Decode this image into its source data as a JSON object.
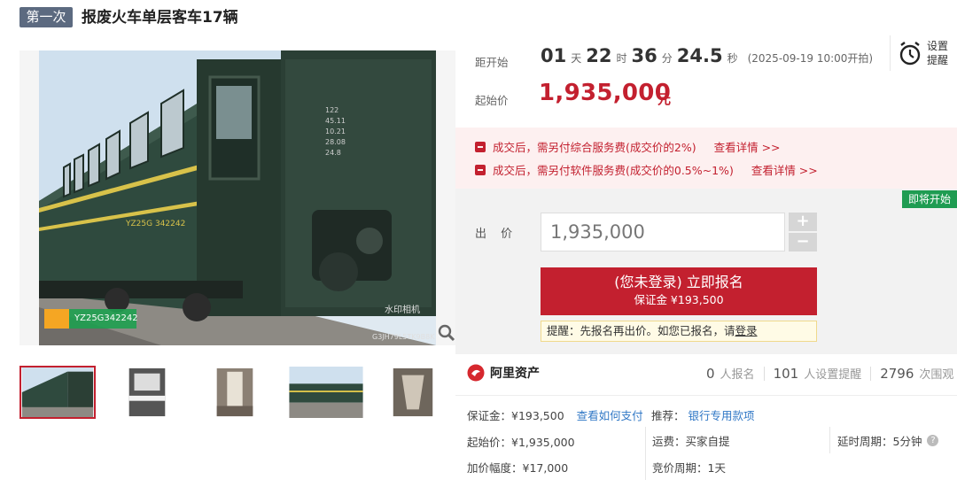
{
  "header": {
    "round_tag": "第一次",
    "title": "报废火车单层客车17辆"
  },
  "gallery": {
    "plate_text": "YZ25G342242",
    "thumbnails": [
      "thumb-1",
      "thumb-2",
      "thumb-3",
      "thumb-4",
      "thumb-5"
    ]
  },
  "countdown": {
    "label": "距开始",
    "days": "01",
    "days_unit": "天",
    "hours": "22",
    "hours_unit": "时",
    "minutes": "36",
    "minutes_unit": "分",
    "seconds": "24.5",
    "seconds_unit": "秒",
    "start_note": "(2025-09-19 10:00开拍)"
  },
  "alarm": {
    "line1": "设置",
    "line2": "提醒",
    "icon": "alarm-clock-icon"
  },
  "starting_price": {
    "label": "起始价",
    "value": "1,935,000",
    "unit": "元"
  },
  "fees": [
    {
      "text": "成交后，需另付综合服务费(成交价的2%)",
      "link": "查看详情 >>"
    },
    {
      "text": "成交后，需另付软件服务费(成交价的0.5%~1%)",
      "link": "查看详情 >>"
    }
  ],
  "bid": {
    "status_badge": "即将开始",
    "label": "出 价",
    "value": "1,935,000",
    "plus": "+",
    "minus": "−",
    "button_line1": "(您未登录) 立即报名",
    "button_line2": "保证金 ¥193,500",
    "tip_prefix": "提醒：先报名再出价。如您已报名，请",
    "tip_link": "登录"
  },
  "brand": {
    "name": "阿里资产"
  },
  "stats": {
    "signups": "0",
    "signups_unit": "人报名",
    "reminders": "101",
    "reminders_unit": "人设置提醒",
    "views": "2796",
    "views_unit": "次围观"
  },
  "info": {
    "deposit_label": "保证金：",
    "deposit_value": "¥193,500",
    "deposit_link": "查看如何支付",
    "recommend_label": "推荐：",
    "recommend_link": "银行专用款项",
    "start_label": "起始价：",
    "start_value": "¥1,935,000",
    "freight_label": "运费：",
    "freight_value": "买家自提",
    "delay_label": "延时周期：",
    "delay_value": "5分钟",
    "increment_label": "加价幅度：",
    "increment_value": "¥17,000",
    "cycle_label": "竞价周期：",
    "cycle_value": "1天"
  },
  "colors": {
    "accent_red": "#c3202f",
    "badge_green": "#1f9c52",
    "link_blue": "#3178c6",
    "tag_gray": "#5c6a80"
  }
}
